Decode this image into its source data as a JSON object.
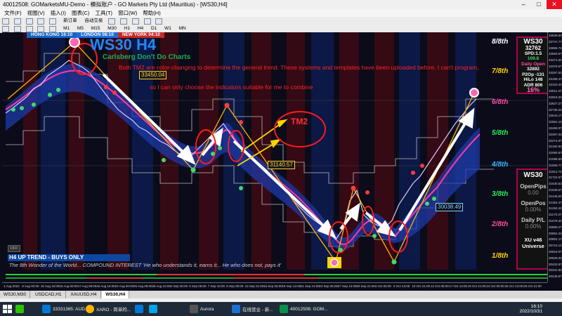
{
  "window": {
    "title": "40012508: GOMarketsMU-Demo - 模拟账户 - GO Markets Pty Ltd (Mauritius) - [WS30,H4]"
  },
  "menu": [
    "文件(F)",
    "视图(V)",
    "插入(I)",
    "图表(C)",
    "工具(T)",
    "窗口(W)",
    "帮助(H)"
  ],
  "toolbar": {
    "items": [
      "新订单",
      "自动交易"
    ],
    "timeframes": [
      "M1",
      "M5",
      "M15",
      "M30",
      "H1",
      "H4",
      "D1",
      "W1",
      "MN"
    ]
  },
  "chart": {
    "sessions": [
      "HONG KONG 16:10",
      "LONDON 08:10",
      "NEW YORK 04:10"
    ],
    "big_title": "WS30 H4",
    "subtitle": "Carlsberg Don't Do Charts",
    "note_line1": "Both TM2 are color-changing to determine the general trend. These systems and templates have been uploaded before. I can't program,",
    "note_line2": "so I can only choose the indicators suitable for me to combine",
    "tm2_label": "TM2",
    "price_labels": [
      "33450.04",
      "31140.57",
      "30038.49"
    ],
    "octaves": [
      {
        "label": "8/8th",
        "color": "#ffffff"
      },
      {
        "label": "7/8th",
        "color": "#ffd400"
      },
      {
        "label": "6/8th",
        "color": "#ff4da6"
      },
      {
        "label": "5/8th",
        "color": "#22ee55"
      },
      {
        "label": "4/8th",
        "color": "#35b8ff"
      },
      {
        "label": "3/8th",
        "color": "#22ee55"
      },
      {
        "label": "2/8th",
        "color": "#ff4da6"
      },
      {
        "label": "1/8th",
        "color": "#ffd400"
      }
    ],
    "trend_banner": "H4 UP TREND - BUYS ONLY",
    "quote": "The 8th Wonder of the World... COMPOUND INTEREST 'He who understands it, earns it... He who does not, pays it'",
    "off_button": "OFF"
  },
  "info_panel": {
    "symbol": "WS30",
    "price": "32762",
    "spread": "SPD:1.5",
    "change": "109.8",
    "daily_open_label": "Daily Open",
    "daily_open": "32892",
    "p2op_label": "P2Op",
    "p2op": "-131",
    "hilo_label": "HiLo",
    "hilo": "148",
    "adr_label": "ADR",
    "adr": "806",
    "pct": "16%"
  },
  "positions_panel": {
    "symbol": "WS30",
    "open_pips_label": "OpenPips",
    "open_pips": "0.00",
    "open_pos_label": "OpenPos",
    "open_pos": "0.00%",
    "daily_pl_label": "Daily P/L",
    "daily_pl": "0.00%",
    "version": "XU v46 Universe"
  },
  "price_axis": [
    "33839.82",
    "33747.77",
    "33656.72",
    "33563.67",
    "33471.62",
    "33379.57",
    "33287.52",
    "33195.47",
    "33103.42",
    "33011.37",
    "32919.32",
    "32827.27",
    "32735.22",
    "32643.17",
    "32551.12",
    "32459.07",
    "32367.02",
    "32274.97",
    "32182.92",
    "32090.87",
    "31998.82",
    "31906.77",
    "31814.72",
    "31722.67",
    "31630.62",
    "31538.57",
    "31446.52",
    "31354.47",
    "31262.42",
    "31170.37",
    "31078.32",
    "30986.27",
    "30894.22",
    "30802.17",
    "30710.12",
    "30618.07",
    "30526.02",
    "30433.97",
    "30341.92",
    "30249.87"
  ],
  "time_axis": [
    "1 Aug 2022",
    "8 Aug 00:00",
    "10 Aug 16:00",
    "15 Aug 00:00",
    "17 Aug 08:00",
    "19 Aug 16:00",
    "24 Aug 00:00",
    "26 Aug 08:00",
    "30 Aug 16:00",
    "2 Sep 00:00",
    "5 Sep 08:00",
    "7 Sep 16:00",
    "9 Sep 00:00",
    "13 Sep 21:00",
    "15 Sep 05:00",
    "19 Sep 13:00",
    "21 Sep 21:00",
    "23 Sep 05:00",
    "27 Sep 13:00",
    "29 Sep 21:00",
    "4 Oct 05:00",
    "6 Oct 13:00",
    "10 Oct 21:00",
    "13 Oct 05:00",
    "17 Oct 13:00",
    "19 Oct 21:00",
    "24 Oct 05:00",
    "26 Oct 13:00",
    "28 Oct 21:00"
  ],
  "tabs": [
    "WS30,M30",
    "USDCAD,H1",
    "XAUUSD,H4",
    "WS30,H4"
  ],
  "taskbar": {
    "apps": [
      "33331365: AUD...",
      "XARO - 简单的...",
      "",
      "",
      "Aurora",
      "在线营业 - 新...",
      "40012508: GOM..."
    ],
    "time": "16:10",
    "date": "2022/10/31"
  },
  "colors": {
    "accent_blue": "#1e88ff",
    "note_red": "#ff2222",
    "panel_border": "#b3004d",
    "bull_green": "#22ee55"
  }
}
